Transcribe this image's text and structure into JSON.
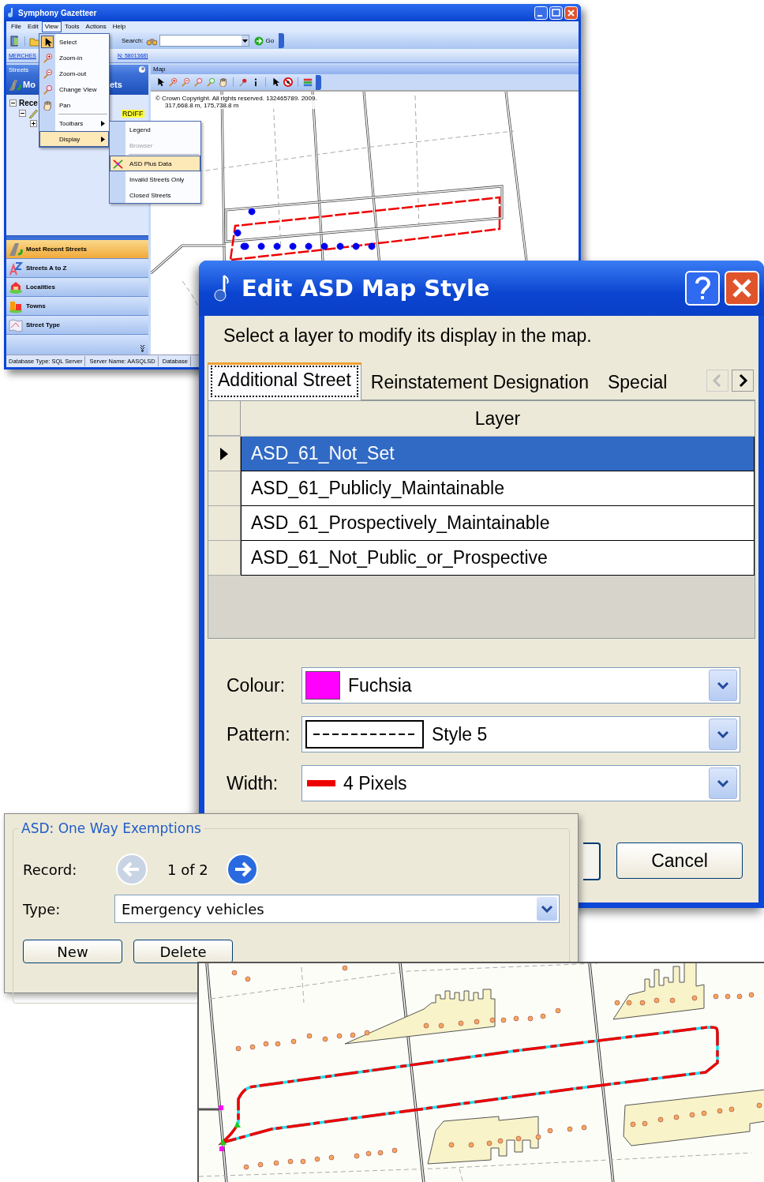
{
  "main_window": {
    "title": "Symphony Gazetteer",
    "menu": [
      {
        "label": "File",
        "selected": false
      },
      {
        "label": "Edit",
        "selected": false
      },
      {
        "label": "View",
        "selected": true
      },
      {
        "label": "Tools",
        "selected": false
      },
      {
        "label": "Actions",
        "selected": false
      },
      {
        "label": "Help",
        "selected": false
      }
    ],
    "search": {
      "label": "Search:",
      "button": "Go"
    },
    "link_bar": [
      "MERCHES",
      "N: 5801368]"
    ],
    "streets_pane": {
      "title": "Streets",
      "header": [
        "Mo",
        "ets"
      ],
      "tree_root": "Rece",
      "tree_highlight": "RDIFF",
      "nav": [
        {
          "label": "Most Recent Streets",
          "selected": true
        },
        {
          "label": "Streets A to Z",
          "selected": false
        },
        {
          "label": "Localities",
          "selected": false
        },
        {
          "label": "Towns",
          "selected": false
        },
        {
          "label": "Street Type",
          "selected": false
        }
      ]
    },
    "map_pane": {
      "title": "Map",
      "copyright": "© Crown Copyright. All rights reserved. 132465789. 2009.",
      "coordinates": "317,668.8 m, 175,738.8 m"
    },
    "status_bar": [
      "Database Type: SQL Server",
      "Server Name: AASQLSD",
      "Database"
    ]
  },
  "view_menu": {
    "items": [
      {
        "label": "Select",
        "kind": "item",
        "checked": true,
        "selected": false
      },
      {
        "label": "Zoom-in",
        "kind": "item",
        "checked": false,
        "selected": false
      },
      {
        "label": "Zoom-out",
        "kind": "item",
        "checked": false,
        "selected": false
      },
      {
        "label": "Change View",
        "kind": "item",
        "checked": false,
        "selected": false
      },
      {
        "label": "Pan",
        "kind": "item",
        "checked": false,
        "selected": false
      },
      {
        "label": "Toolbars",
        "kind": "submenu",
        "checked": false,
        "selected": false
      },
      {
        "label": "Display",
        "kind": "submenu",
        "checked": false,
        "selected": true
      }
    ]
  },
  "display_menu": {
    "items": [
      {
        "label": "Legend",
        "disabled": false,
        "selected": false
      },
      {
        "label": "Browser",
        "disabled": true,
        "selected": false
      },
      {
        "label": "ASD Plus Data",
        "disabled": false,
        "selected": true
      },
      {
        "label": "Invalid Streets Only",
        "disabled": false,
        "selected": false
      },
      {
        "label": "Closed Streets",
        "disabled": false,
        "selected": false
      }
    ]
  },
  "dialog": {
    "title": "Edit ASD Map Style",
    "instruction": "Select a layer to modify its display in the map.",
    "tabs": [
      {
        "label": "Additional Street",
        "selected": true
      },
      {
        "label": "Reinstatement Designation",
        "selected": false
      },
      {
        "label": "Special",
        "selected": false
      }
    ],
    "grid": {
      "column": "Layer",
      "rows": [
        {
          "name": "ASD_61_Not_Set",
          "selected": true
        },
        {
          "name": "ASD_61_Publicly_Maintainable",
          "selected": false
        },
        {
          "name": "ASD_61_Prospectively_Maintainable",
          "selected": false
        },
        {
          "name": "ASD_61_Not_Public_or_Prospective",
          "selected": false
        }
      ]
    },
    "colour": {
      "label": "Colour:",
      "value": "Fuchsia",
      "color": "#ff00ff"
    },
    "pattern": {
      "label": "Pattern:",
      "value": "Style 5"
    },
    "width": {
      "label": "Width:",
      "value": "4 Pixels"
    },
    "buttons": [
      "Cancel"
    ]
  },
  "exemptions": {
    "title": "ASD: One Way Exemptions",
    "record_label": "Record:",
    "record": "1 of 2",
    "previous_disabled": true,
    "type_label": "Type:",
    "type": "Emergency vehicles",
    "buttons": [
      "New",
      "Delete"
    ]
  }
}
